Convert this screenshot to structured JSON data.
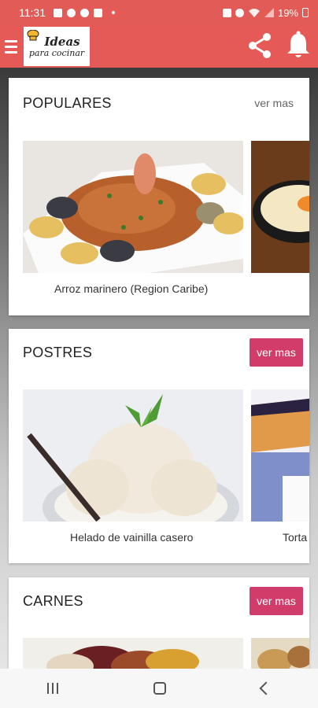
{
  "status_bar": {
    "time": "11:31",
    "battery": "19%"
  },
  "app_bar": {
    "logo_line1": "Ideas",
    "logo_line2": "para cocinar",
    "icons": [
      "menu-icon",
      "share-icon",
      "bell-icon"
    ]
  },
  "sections": [
    {
      "title": "POPULARES",
      "more": "ver mas",
      "items": [
        {
          "label": "Arroz marinero (Region Caribe)"
        },
        {
          "label": ""
        }
      ]
    },
    {
      "title": "POSTRES",
      "more": "ver mas",
      "items": [
        {
          "label": "Helado de vainilla casero"
        },
        {
          "label": "Torta"
        }
      ]
    },
    {
      "title": "CARNES",
      "more": "ver mas",
      "items": []
    }
  ],
  "colors": {
    "accent": "#e55a56",
    "button": "#d23c6a"
  }
}
